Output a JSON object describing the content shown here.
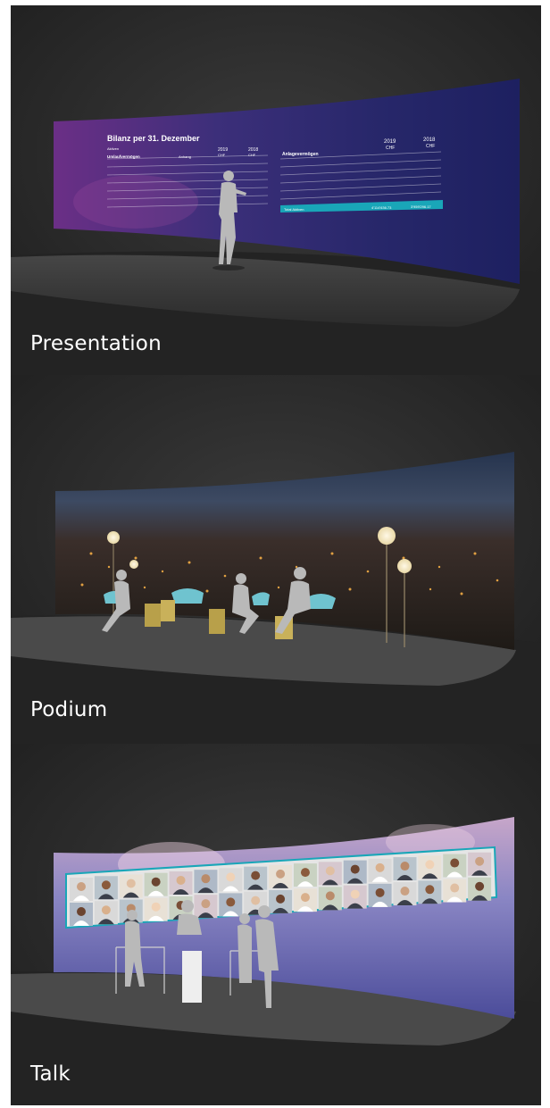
{
  "panels": [
    {
      "caption": "Presentation"
    },
    {
      "caption": "Podium"
    },
    {
      "caption": "Talk"
    }
  ],
  "presentation_slide": {
    "title": "Bilanz per 31. Dezember",
    "left_header": "Aktiven",
    "left_col_years": [
      "2019",
      "2018"
    ],
    "left_col_units": [
      "CHF",
      "CHF"
    ],
    "left_section": "Umlaufvermögen",
    "left_section_note": "Anhang",
    "right_header": "Anlagevermögen",
    "right_col_years": [
      "2019",
      "2018"
    ],
    "right_col_units": [
      "CHF",
      "CHF"
    ],
    "right_total_label": "Total Aktiven",
    "right_total_values": [
      "4'114'636.73",
      "3'959'296.17"
    ]
  },
  "colors": {
    "panel_bg": "#2a2a2a",
    "presentation_screen": "#2b2a6e",
    "talk_screen": "#5a5a9e",
    "highlight_bar": "#19a6b8"
  }
}
